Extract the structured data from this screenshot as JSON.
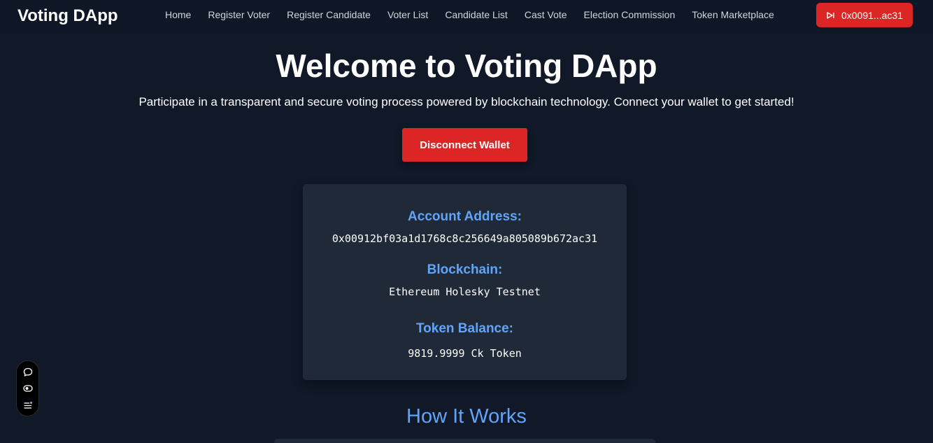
{
  "navbar": {
    "brand": "Voting DApp",
    "links": [
      {
        "label": "Home"
      },
      {
        "label": "Register Voter"
      },
      {
        "label": "Register Candidate"
      },
      {
        "label": "Voter List"
      },
      {
        "label": "Candidate List"
      },
      {
        "label": "Cast Vote"
      },
      {
        "label": "Election Commission"
      },
      {
        "label": "Token Marketplace"
      }
    ],
    "wallet_chip": {
      "label": "0x0091...ac31",
      "icon": "wallet-disconnect-icon"
    }
  },
  "hero": {
    "title": "Welcome to Voting DApp",
    "subtitle": "Participate in a transparent and secure voting process powered by blockchain technology. Connect your wallet to get started!",
    "button_label": "Disconnect Wallet"
  },
  "account_card": {
    "address_label": "Account Address:",
    "address_value": "0x00912bf03a1d1768c8c256649a805089b672ac31",
    "blockchain_label": "Blockchain:",
    "blockchain_value": "Ethereum Holesky Testnet",
    "balance_label": "Token Balance:",
    "balance_value": "9819.9999 Ck Token"
  },
  "how_it_works": {
    "title": "How It Works"
  },
  "side_widget": {
    "icons": [
      "chat-icon",
      "eye-toggle-icon",
      "settings-list-icon"
    ]
  },
  "colors": {
    "background": "#111827",
    "navbar": "#0f1625",
    "accent_red": "#dc2626",
    "accent_blue": "#60a5fa",
    "card": "#1f2937"
  }
}
